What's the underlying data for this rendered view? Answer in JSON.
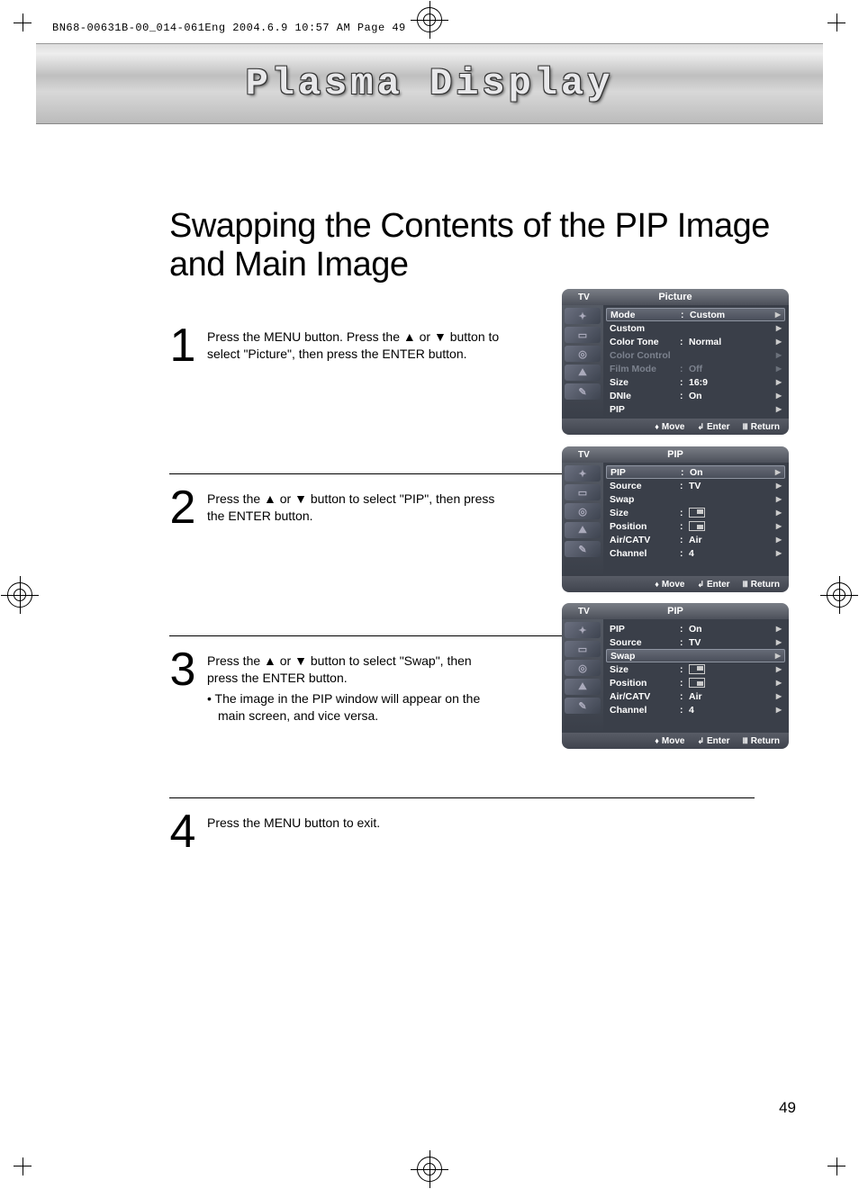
{
  "slug": "BN68-00631B-00_014-061Eng  2004.6.9  10:57 AM  Page 49",
  "banner_title": "Plasma Display",
  "heading": "Swapping the Contents of the PIP Image and Main Image",
  "steps": [
    {
      "num": "1",
      "text": "Press the MENU button. Press the ▲ or ▼ button to select \"Picture\", then press the ENTER button.",
      "bullet": ""
    },
    {
      "num": "2",
      "text": "Press the ▲ or ▼ button to select \"PIP\", then press the ENTER button.",
      "bullet": ""
    },
    {
      "num": "3",
      "text": "Press the ▲ or ▼ button to select \"Swap\", then press the ENTER button.",
      "bullet": "• The image in the PIP window will appear on the main screen, and vice versa."
    },
    {
      "num": "4",
      "text": "Press the MENU button to exit.",
      "bullet": ""
    }
  ],
  "osd": {
    "footer": {
      "move": "Move",
      "enter": "Enter",
      "return": "Return"
    },
    "panel1": {
      "src": "TV",
      "title": "Picture",
      "rows": [
        {
          "label": "Mode",
          "value": "Custom",
          "hl": true
        },
        {
          "label": "Custom",
          "value": ""
        },
        {
          "label": "Color Tone",
          "value": "Normal"
        },
        {
          "label": "Color Control",
          "value": "",
          "dim": true
        },
        {
          "label": "Film Mode",
          "value": "Off",
          "dim": true
        },
        {
          "label": "Size",
          "value": "16:9"
        },
        {
          "label": "DNIe",
          "value": "On"
        },
        {
          "label": "PIP",
          "value": ""
        }
      ]
    },
    "panel2": {
      "src": "TV",
      "title": "PIP",
      "rows": [
        {
          "label": "PIP",
          "value": "On",
          "hl": true
        },
        {
          "label": "Source",
          "value": "TV"
        },
        {
          "label": "Swap",
          "value": ""
        },
        {
          "label": "Size",
          "value": "",
          "icon": "size"
        },
        {
          "label": "Position",
          "value": "",
          "icon": "pos"
        },
        {
          "label": "Air/CATV",
          "value": "Air"
        },
        {
          "label": "Channel",
          "value": "4"
        }
      ]
    },
    "panel3": {
      "src": "TV",
      "title": "PIP",
      "rows": [
        {
          "label": "PIP",
          "value": "On"
        },
        {
          "label": "Source",
          "value": "TV"
        },
        {
          "label": "Swap",
          "value": "",
          "hl": true
        },
        {
          "label": "Size",
          "value": "",
          "icon": "size"
        },
        {
          "label": "Position",
          "value": "",
          "icon": "pos"
        },
        {
          "label": "Air/CATV",
          "value": "Air"
        },
        {
          "label": "Channel",
          "value": "4"
        }
      ]
    }
  },
  "page_number": "49"
}
